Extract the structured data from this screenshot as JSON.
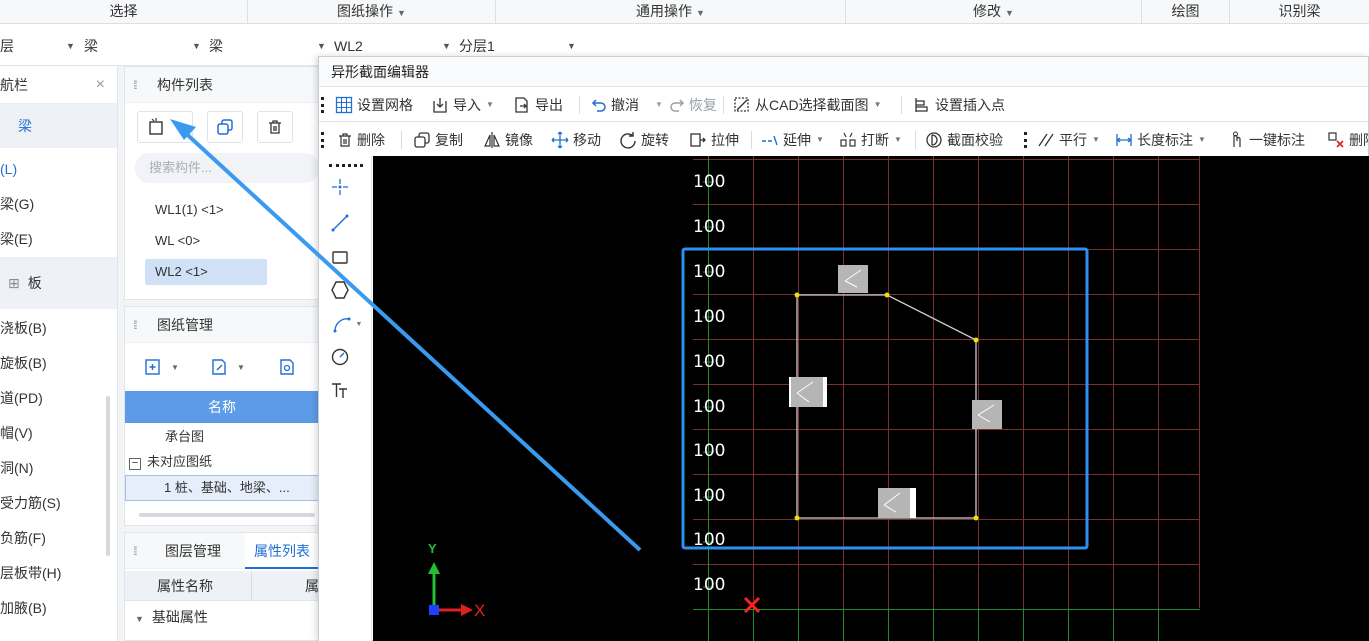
{
  "ribbon": {
    "groups": [
      "选择",
      "图纸操作",
      "通用操作",
      "修改",
      "绘图",
      "识别梁"
    ]
  },
  "combos": [
    "层",
    "梁",
    "梁",
    "WL2",
    "分层1"
  ],
  "leftnav": {
    "title": "导航栏",
    "close": "×",
    "category_beam": "梁",
    "beam_items": [
      "(L)",
      "梁(G)",
      "梁(E)"
    ],
    "category_slab": "板",
    "slab_items": [
      "浇板(B)",
      "旋板(B)",
      "道(PD)",
      "帽(V)",
      "洞(N)",
      "受力筋(S)",
      "负筋(F)",
      "层板带(H)",
      "加腋(B)"
    ]
  },
  "component_list": {
    "title": "构件列表",
    "search_placeholder": "搜索构件...",
    "items": [
      "WL1(1) <1>",
      "WL <0>",
      "WL2 <1>"
    ],
    "selected": "WL2 <1>"
  },
  "drawing_mgmt": {
    "title": "图纸管理",
    "col_name": "名称",
    "rows": [
      "承台图",
      "未对应图纸",
      "1   桩、基础、地梁、..."
    ]
  },
  "properties": {
    "tab_layers": "图层管理",
    "tab_props": "属性列表",
    "col_name": "属性名称",
    "col_value": "属",
    "section": "基础属性"
  },
  "editor": {
    "title": "异形截面编辑器",
    "toolbar1": {
      "grid": "设置网格",
      "import": "导入",
      "export": "导出",
      "undo": "撤消",
      "redo": "恢复",
      "from_cad": "从CAD选择截面图",
      "insert_point": "设置插入点"
    },
    "toolbar2": {
      "delete": "删除",
      "copy": "复制",
      "mirror": "镜像",
      "move": "移动",
      "rotate": "旋转",
      "stretch": "拉伸",
      "extend": "延伸",
      "break": "打断",
      "check": "截面校验",
      "parallel": "平行",
      "length_dim": "长度标注",
      "auto_dim": "一键标注",
      "remove_dim": "删除"
    },
    "grid_labels": [
      "100",
      "100",
      "100",
      "100",
      "100",
      "100",
      "100",
      "100",
      "100",
      "100"
    ],
    "axis_x": "X",
    "axis_y": "Y"
  },
  "colors": {
    "accent": "#1f6fd6",
    "highlight_box": "#2e90f0",
    "grid_red": "#7a2f2f",
    "grid_green": "#1f8a2a"
  }
}
